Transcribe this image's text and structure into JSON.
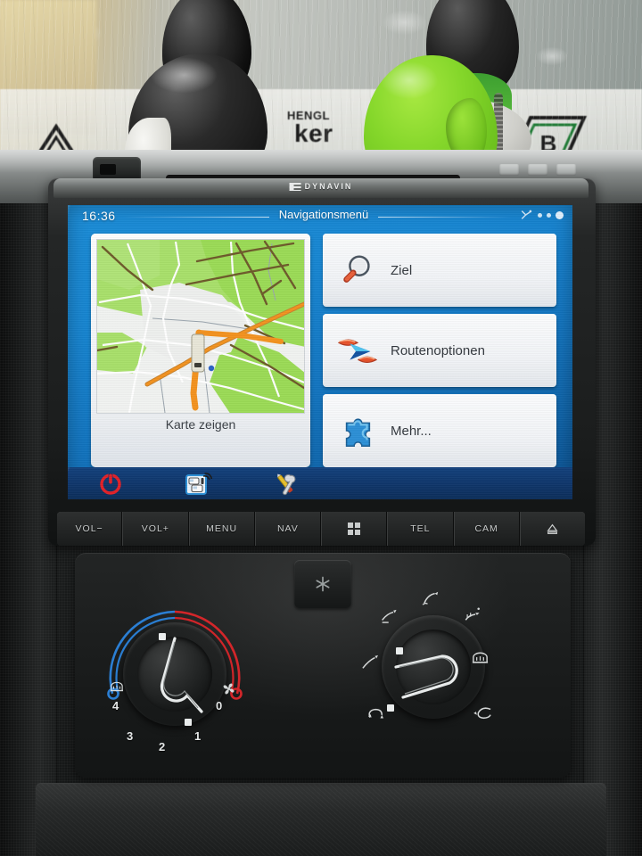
{
  "device": {
    "brand": "DYNAVIN",
    "brand_mark": "dynavin-logo"
  },
  "screen": {
    "clock": "16:36",
    "title": "Navigationsmenü",
    "status": {
      "satellite_icon": "satellite-icon",
      "signal_dots": 3
    },
    "map_card": {
      "caption": "Karte zeigen",
      "icon": "map-preview",
      "colors": {
        "land": "#f1f3f1",
        "green": "#a8e06a",
        "green_dark": "#8fd44f",
        "road_major": "#f3921e",
        "road_minor": "#ffffff",
        "road_outline": "#9aa4ad",
        "track": "#6d5a2a",
        "position_dot": "#2b62c4"
      }
    },
    "menu_items": [
      {
        "label": "Ziel",
        "icon": "magnifier-icon"
      },
      {
        "label": "Routenoptionen",
        "icon": "route-arrow-icon"
      },
      {
        "label": "Mehr...",
        "icon": "puzzle-piece-icon"
      }
    ],
    "toolbar": [
      {
        "name": "power-button",
        "icon": "power-icon"
      },
      {
        "name": "traffic-tmc-button",
        "icon": "traffic-cars-antenna-icon"
      },
      {
        "name": "settings-button",
        "icon": "wrench-screwdriver-icon"
      }
    ],
    "colors": {
      "bg_top": "#1a8bd6",
      "bg_bottom": "#0a4f8e",
      "toolbar": "#0e3569",
      "panel": "#f2f4f7",
      "text": "#33383e"
    }
  },
  "hard_buttons": [
    {
      "label": "VOL−",
      "icon": ""
    },
    {
      "label": "VOL+",
      "icon": ""
    },
    {
      "label": "MENU",
      "icon": ""
    },
    {
      "label": "NAV",
      "icon": ""
    },
    {
      "label": "",
      "icon": "grid-apps-icon"
    },
    {
      "label": "TEL",
      "icon": ""
    },
    {
      "label": "CAM",
      "icon": ""
    },
    {
      "label": "",
      "icon": "eject-icon"
    }
  ],
  "climate": {
    "ac_button": {
      "name": "ac-button",
      "icon": "snowflake-icon"
    },
    "temperature_knob": {
      "name": "temperature-fan-knob",
      "fan_labels": [
        "0",
        "1",
        "2",
        "3",
        "4"
      ],
      "fan_icon": "fan-icon",
      "defrost_icon": "rear-defrost-icon",
      "cold_color": "#2b7fd4",
      "hot_color": "#d3262a",
      "selected": "1"
    },
    "vent_knob": {
      "name": "air-distribution-knob",
      "positions": [
        "vent-face-icon",
        "vent-face-feet-icon",
        "vent-feet-icon",
        "vent-windshield-icon",
        "vent-defrost-icon",
        "vent-recirculation-icon",
        "vent-fresh-air-icon"
      ],
      "selected": "vent-recirculation-icon"
    }
  },
  "decor": {
    "ducks": [
      {
        "name": "duck-black-white-back",
        "colors": [
          "#1a1a1a",
          "#eeeeea",
          "#4fb234"
        ]
      },
      {
        "name": "duck-black-white-front",
        "colors": [
          "#141414",
          "#f2f2ee"
        ]
      },
      {
        "name": "duck-green",
        "colors": [
          "#84d62a",
          "#5eb417"
        ]
      },
      {
        "name": "duck-black-white-right",
        "colors": [
          "#1a1a1a",
          "#e9e9e4",
          "#4fb234"
        ]
      }
    ],
    "banner": {
      "line1": "HENGL",
      "line2": "ker"
    }
  }
}
